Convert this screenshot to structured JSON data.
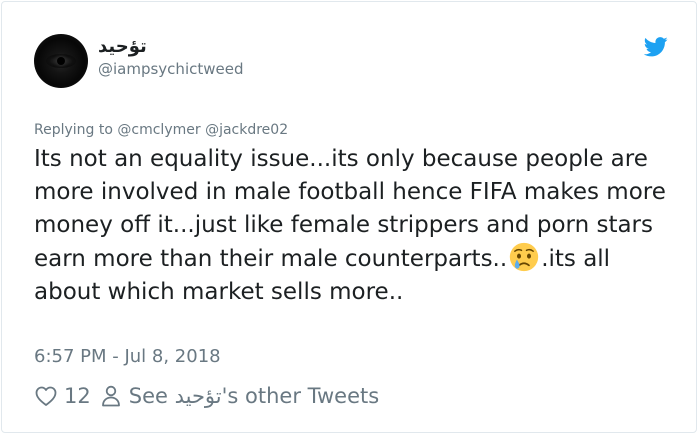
{
  "author": {
    "display_name": "تؤحيد",
    "handle": "@iampsychictweed",
    "avatar_icon": "dark-eye-avatar"
  },
  "brand": {
    "icon": "twitter-bird-icon",
    "color": "#1da1f2"
  },
  "reply": {
    "prefix": "Replying to",
    "mentions": [
      "@cmclymer",
      "@jackdre02"
    ]
  },
  "tweet": {
    "text_before_emoji": "Its not an equality issue...its only because people are  more involved in male football hence FIFA makes more money off it...just like female strippers and porn stars earn more than their male counterparts..",
    "emoji": "crying-face",
    "text_after_emoji": ".its all about which market sells more..",
    "timestamp": "6:57 PM - Jul 8, 2018"
  },
  "actions": {
    "like_count": "12",
    "like_icon": "heart-icon",
    "profile_icon": "person-icon",
    "other_tweets_label": "See تؤحيد's other Tweets"
  },
  "colors": {
    "text": "#1c2022",
    "secondary": "#697882",
    "border": "#e1e8ed"
  }
}
